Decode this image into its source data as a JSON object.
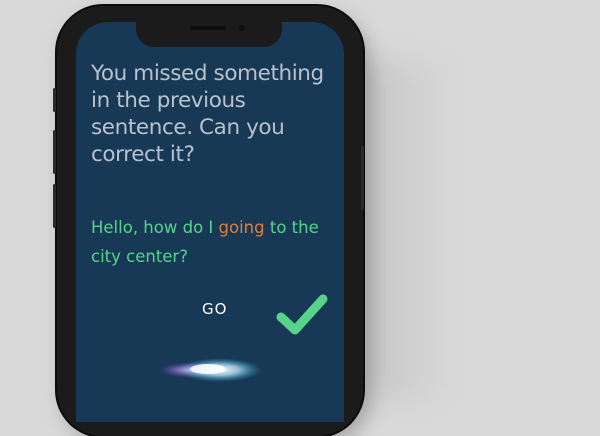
{
  "prompt": {
    "text": "You missed something in the previous sentence. Can you correct it?"
  },
  "sentence": {
    "before": "Hello, how do I ",
    "highlight": "going",
    "after": " to the city center?",
    "color": "#57d48a",
    "highlight_color": "#e27d3f"
  },
  "action": {
    "go_label": "GO",
    "confirm_icon": "checkmark-icon",
    "confirm_color": "#57d48a"
  },
  "voice": {
    "indicator_icon": "siri-waveform-icon"
  },
  "colors": {
    "screen_background": "#173955",
    "prompt_text": "#b9c2cc"
  }
}
